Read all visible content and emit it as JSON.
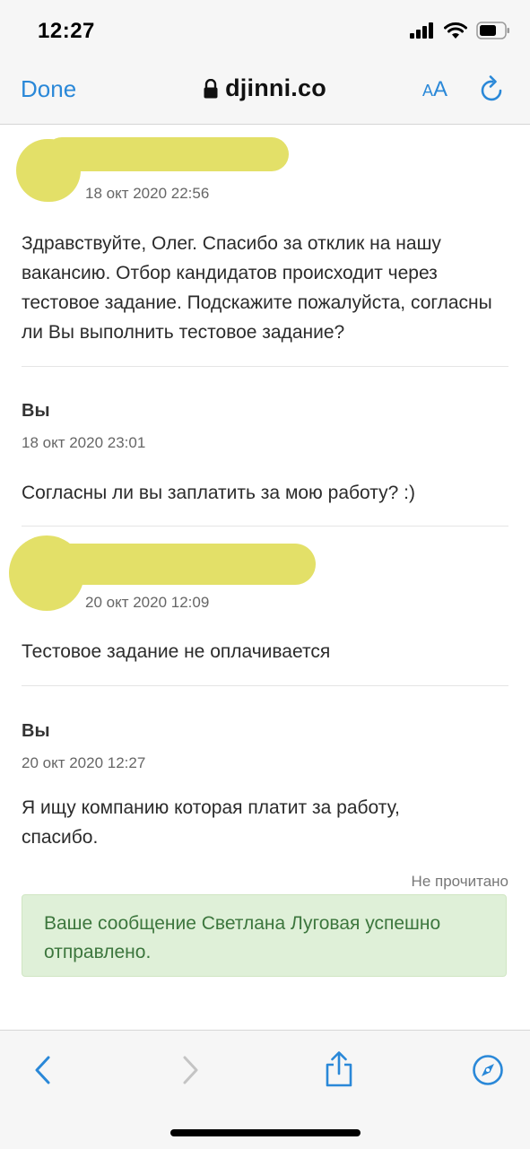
{
  "status_bar": {
    "time": "12:27"
  },
  "browser": {
    "done_label": "Done",
    "url": "djinni.co",
    "text_size_label_small": "A",
    "text_size_label_large": "A",
    "accent_color": "#2a88d8"
  },
  "messages": [
    {
      "sender": "",
      "sender_redacted": true,
      "time": "18 окт 2020 22:56",
      "text": "Здравствуйте, Олег. Спасибо за отклик на нашу вакансию. Отбор кандидатов происходит через тестовое задание. Подскажите пожалуйста, согласны ли Вы выполнить тестовое задание?"
    },
    {
      "sender": "Вы",
      "sender_redacted": false,
      "time": "18 окт 2020 23:01",
      "text": "Согласны ли вы заплатить за мою работу? :)"
    },
    {
      "sender": "",
      "sender_redacted": true,
      "time": "20 окт 2020 12:09",
      "text": "Тестовое задание не оплачивается"
    },
    {
      "sender": "Вы",
      "sender_redacted": false,
      "time": "20 окт 2020 12:27",
      "text": "Я ищу компанию которая платит за работу, спасибо."
    }
  ],
  "read_status": "Не прочитано",
  "alert": {
    "text": "Ваше сообщение Светлана Луговая успешно отправлено.",
    "color": "#3c763d",
    "background": "#dff0d8"
  },
  "toolbar": {
    "icons": [
      "back-icon",
      "forward-icon",
      "share-icon",
      "compass-icon"
    ]
  }
}
